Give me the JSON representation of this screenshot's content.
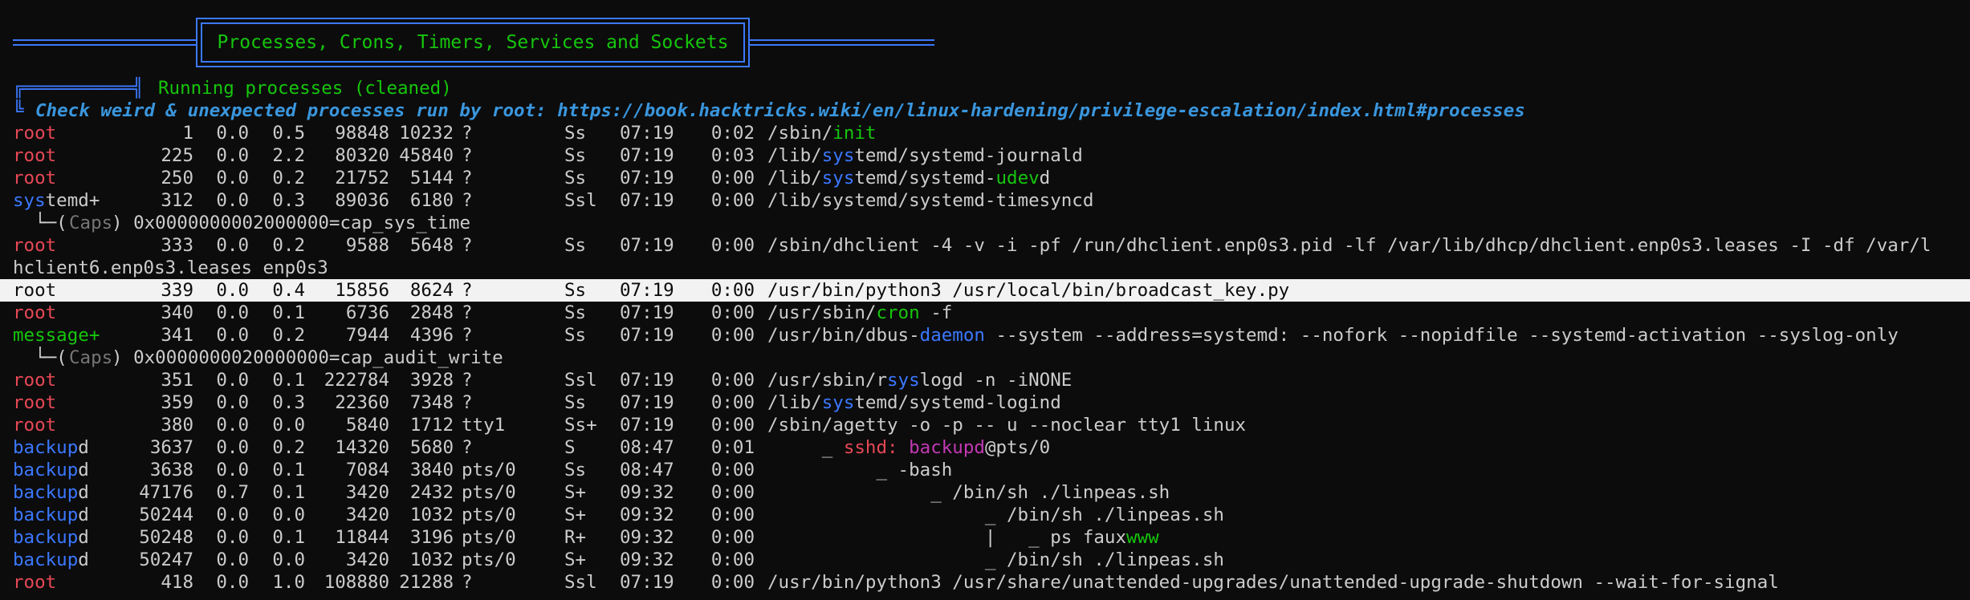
{
  "banner": {
    "title": "Processes, Crons, Timers, Services and Sockets"
  },
  "section": {
    "box_glyph": "╔══════════╣",
    "title": "Running processes (cleaned)",
    "hint_glyph": "╚",
    "hint": "Check weird & unexpected processes run by root: https://book.hacktricks.wiki/en/linux-hardening/privilege-escalation/index.html#processes"
  },
  "processes": [
    {
      "user": "root",
      "user_color": "red",
      "pid": "1",
      "cpu": "0.0",
      "mem": "0.5",
      "vsz": "98848",
      "rss": "10232",
      "tty": "?",
      "stat": "Ss",
      "start": "07:19",
      "time": "0:02",
      "cmd": [
        {
          "t": "/sbin/"
        },
        {
          "t": "init",
          "c": "green"
        }
      ]
    },
    {
      "user": "root",
      "user_color": "red",
      "pid": "225",
      "cpu": "0.0",
      "mem": "2.2",
      "vsz": "80320",
      "rss": "45840",
      "tty": "?",
      "stat": "Ss",
      "start": "07:19",
      "time": "0:03",
      "cmd": [
        {
          "t": "/lib/"
        },
        {
          "t": "sys",
          "c": "blue"
        },
        {
          "t": "temd/systemd-journald"
        }
      ]
    },
    {
      "user": "root",
      "user_color": "red",
      "pid": "250",
      "cpu": "0.0",
      "mem": "0.2",
      "vsz": "21752",
      "rss": "5144",
      "tty": "?",
      "stat": "Ss",
      "start": "07:19",
      "time": "0:00",
      "cmd": [
        {
          "t": "/lib/"
        },
        {
          "t": "sys",
          "c": "blue"
        },
        {
          "t": "temd/systemd-"
        },
        {
          "t": "udev",
          "c": "green"
        },
        {
          "t": "d"
        }
      ]
    },
    {
      "user_parts": [
        {
          "t": "sys",
          "c": "blue"
        },
        {
          "t": "temd+"
        }
      ],
      "pid": "312",
      "cpu": "0.0",
      "mem": "0.3",
      "vsz": "89036",
      "rss": "6180",
      "tty": "?",
      "stat": "Ssl",
      "start": "07:19",
      "time": "0:00",
      "cmd": [
        {
          "t": "/lib/systemd/systemd-timesyncd"
        }
      ]
    },
    {
      "caps": true,
      "pre": "  └─(",
      "caps_word": "Caps",
      "post": ") 0x0000000002000000=cap_sys_time"
    },
    {
      "user": "root",
      "user_color": "red",
      "pid": "333",
      "cpu": "0.0",
      "mem": "0.2",
      "vsz": "9588",
      "rss": "5648",
      "tty": "?",
      "stat": "Ss",
      "start": "07:19",
      "time": "0:00",
      "cmd": [
        {
          "t": "/sbin/dhclient -4 -v -i -pf /run/dhclient.enp0s3.pid -lf /var/lib/dhcp/dhclient.enp0s3.leases -I -df /var/l"
        }
      ]
    },
    {
      "wrap": "hclient6.enp0s3.leases enp0s3"
    },
    {
      "user": "root",
      "highlight": true,
      "pid": "339",
      "cpu": "0.0",
      "mem": "0.4",
      "vsz": "15856",
      "rss": "8624",
      "tty": "?",
      "stat": "Ss",
      "start": "07:19",
      "time": "0:00",
      "cmd": [
        {
          "t": "/usr/bin/python3 /usr/local/bin/broadcast_key.py"
        }
      ]
    },
    {
      "user": "root",
      "user_color": "red",
      "pid": "340",
      "cpu": "0.0",
      "mem": "0.1",
      "vsz": "6736",
      "rss": "2848",
      "tty": "?",
      "stat": "Ss",
      "start": "07:19",
      "time": "0:00",
      "cmd": [
        {
          "t": "/usr/sbin/"
        },
        {
          "t": "cron",
          "c": "green"
        },
        {
          "t": " -f"
        }
      ]
    },
    {
      "user": "message+",
      "user_color": "green",
      "pid": "341",
      "cpu": "0.0",
      "mem": "0.2",
      "vsz": "7944",
      "rss": "4396",
      "tty": "?",
      "stat": "Ss",
      "start": "07:19",
      "time": "0:00",
      "cmd": [
        {
          "t": "/usr/bin/dbus-"
        },
        {
          "t": "daemon",
          "c": "blue"
        },
        {
          "t": " --system --address=systemd: --nofork --nopidfile --systemd-activation --syslog-only"
        }
      ]
    },
    {
      "caps": true,
      "pre": "  └─(",
      "caps_word": "Caps",
      "post": ") 0x0000000020000000=cap_audit_write"
    },
    {
      "user": "root",
      "user_color": "red",
      "pid": "351",
      "cpu": "0.0",
      "mem": "0.1",
      "vsz": "222784",
      "rss": "3928",
      "tty": "?",
      "stat": "Ssl",
      "start": "07:19",
      "time": "0:00",
      "cmd": [
        {
          "t": "/usr/sbin/r"
        },
        {
          "t": "sys",
          "c": "blue"
        },
        {
          "t": "logd -n -iNONE"
        }
      ]
    },
    {
      "user": "root",
      "user_color": "red",
      "pid": "359",
      "cpu": "0.0",
      "mem": "0.3",
      "vsz": "22360",
      "rss": "7348",
      "tty": "?",
      "stat": "Ss",
      "start": "07:19",
      "time": "0:00",
      "cmd": [
        {
          "t": "/lib/"
        },
        {
          "t": "sys",
          "c": "blue"
        },
        {
          "t": "temd/systemd-logind"
        }
      ]
    },
    {
      "user": "root",
      "user_color": "red",
      "pid": "380",
      "cpu": "0.0",
      "mem": "0.0",
      "vsz": "5840",
      "rss": "1712",
      "tty": "tty1",
      "stat": "Ss+",
      "start": "07:19",
      "time": "0:00",
      "cmd": [
        {
          "t": "/sbin/agetty -o -p -- u --noclear tty1 linux"
        }
      ]
    },
    {
      "user_parts": [
        {
          "t": "backup",
          "c": "blue"
        },
        {
          "t": "d"
        }
      ],
      "pid": "3637",
      "cpu": "0.0",
      "mem": "0.2",
      "vsz": "14320",
      "rss": "5680",
      "tty": "?",
      "stat": "S",
      "start": "08:47",
      "time": "0:01",
      "cmd": [
        {
          "t": "     _ "
        },
        {
          "t": "sshd:",
          "c": "red"
        },
        {
          "t": " "
        },
        {
          "t": "backupd",
          "c": "mag"
        },
        {
          "t": "@pts/0"
        }
      ]
    },
    {
      "user_parts": [
        {
          "t": "backup",
          "c": "blue"
        },
        {
          "t": "d"
        }
      ],
      "pid": "3638",
      "cpu": "0.0",
      "mem": "0.1",
      "vsz": "7084",
      "rss": "3840",
      "tty": "pts/0",
      "stat": "Ss",
      "start": "08:47",
      "time": "0:00",
      "cmd": [
        {
          "t": "          _ -bash"
        }
      ]
    },
    {
      "user_parts": [
        {
          "t": "backup",
          "c": "blue"
        },
        {
          "t": "d"
        }
      ],
      "pid": "47176",
      "cpu": "0.7",
      "mem": "0.1",
      "vsz": "3420",
      "rss": "2432",
      "tty": "pts/0",
      "stat": "S+",
      "start": "09:32",
      "time": "0:00",
      "cmd": [
        {
          "t": "               _ /bin/sh ./linpeas.sh"
        }
      ]
    },
    {
      "user_parts": [
        {
          "t": "backup",
          "c": "blue"
        },
        {
          "t": "d"
        }
      ],
      "pid": "50244",
      "cpu": "0.0",
      "mem": "0.0",
      "vsz": "3420",
      "rss": "1032",
      "tty": "pts/0",
      "stat": "S+",
      "start": "09:32",
      "time": "0:00",
      "cmd": [
        {
          "t": "                    _ /bin/sh ./linpeas.sh"
        }
      ]
    },
    {
      "user_parts": [
        {
          "t": "backup",
          "c": "blue"
        },
        {
          "t": "d"
        }
      ],
      "pid": "50248",
      "cpu": "0.0",
      "mem": "0.1",
      "vsz": "11844",
      "rss": "3196",
      "tty": "pts/0",
      "stat": "R+",
      "start": "09:32",
      "time": "0:00",
      "cmd": [
        {
          "t": "                    |   _ ps faux"
        },
        {
          "t": "www",
          "c": "green"
        }
      ]
    },
    {
      "user_parts": [
        {
          "t": "backup",
          "c": "blue"
        },
        {
          "t": "d"
        }
      ],
      "pid": "50247",
      "cpu": "0.0",
      "mem": "0.0",
      "vsz": "3420",
      "rss": "1032",
      "tty": "pts/0",
      "stat": "S+",
      "start": "09:32",
      "time": "0:00",
      "cmd": [
        {
          "t": "                    _ /bin/sh ./linpeas.sh"
        }
      ]
    },
    {
      "user": "root",
      "user_color": "red",
      "pid": "418",
      "cpu": "0.0",
      "mem": "1.0",
      "vsz": "108880",
      "rss": "21288",
      "tty": "?",
      "stat": "Ssl",
      "start": "07:19",
      "time": "0:00",
      "cmd": [
        {
          "t": "/usr/bin/python3 /usr/share/unattended-upgrades/unattended-upgrade-shutdown --wait-for-signal"
        }
      ]
    }
  ]
}
